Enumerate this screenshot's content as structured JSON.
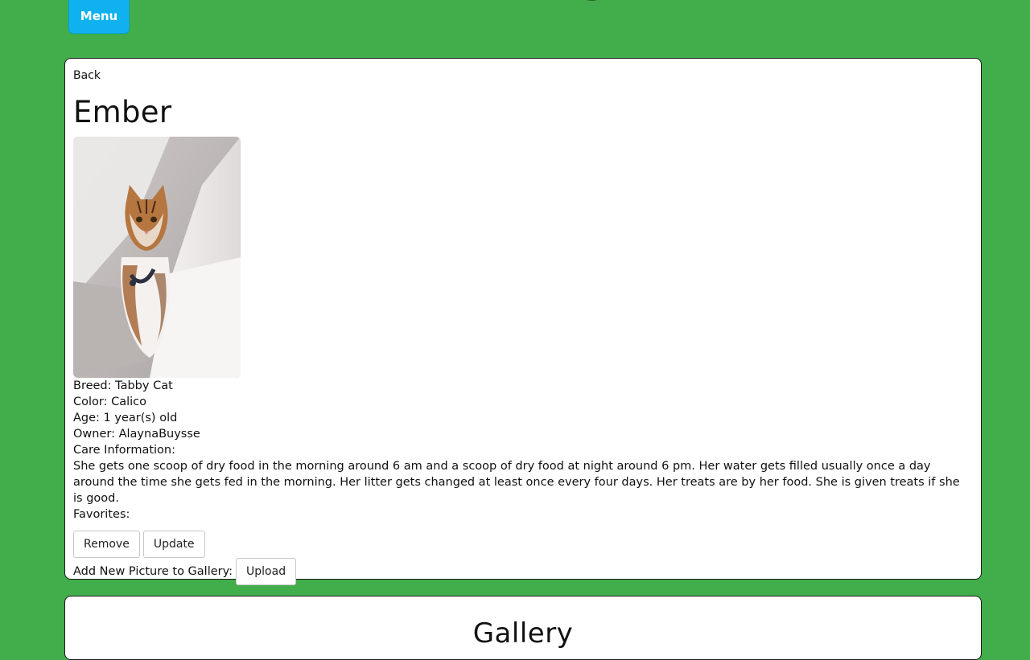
{
  "header": {
    "menu_label": "Menu"
  },
  "pet": {
    "back_label": "Back",
    "name": "Ember",
    "photo_alt": "Ember photo",
    "breed_line": "Breed: Tabby Cat",
    "color_line": "Color: Calico",
    "age_line": "Age: 1 year(s) old",
    "owner_line": "Owner: AlaynaBuysse",
    "care_label": "Care Information:",
    "care_text": "She gets one scoop of dry food in the morning around 6 am and a scoop of dry food at night around 6 pm. Her water gets filled usually once a day around the time she gets fed in the morning. Her litter gets changed at least once every four days. Her treats are by her food. She is given treats if she is good.",
    "favorites_label": "Favorites:"
  },
  "actions": {
    "remove_label": "Remove",
    "update_label": "Update",
    "add_picture_label": "Add New Picture to Gallery:",
    "upload_label": "Upload"
  },
  "gallery": {
    "title": "Gallery"
  },
  "colors": {
    "page_background": "#41ad4b",
    "menu_button": "#0fb2ee",
    "card_background": "#ffffff"
  }
}
